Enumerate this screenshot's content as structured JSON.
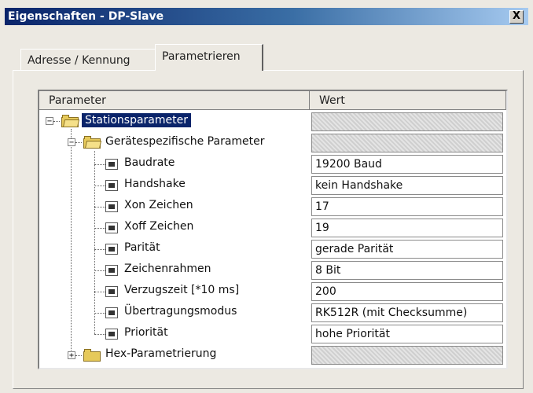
{
  "window": {
    "title": "Eigenschaften - DP-Slave",
    "close_label": "X"
  },
  "tabs": [
    {
      "label": "Adresse / Kennung",
      "active": false
    },
    {
      "label": "Parametrieren",
      "active": true
    }
  ],
  "grid": {
    "columns": [
      "Parameter",
      "Wert"
    ],
    "root": {
      "label": "Stationsparameter",
      "expanded": true,
      "selected": true,
      "value": ""
    },
    "group": {
      "label": "Gerätespezifische Parameter",
      "expanded": true,
      "value": ""
    },
    "params": [
      {
        "label": "Baudrate",
        "value": "19200 Baud"
      },
      {
        "label": "Handshake",
        "value": "kein Handshake"
      },
      {
        "label": "Xon Zeichen",
        "value": "17"
      },
      {
        "label": "Xoff Zeichen",
        "value": "19"
      },
      {
        "label": "Parität",
        "value": "gerade Parität"
      },
      {
        "label": "Zeichenrahmen",
        "value": "8 Bit"
      },
      {
        "label": "Verzugszeit [*10 ms]",
        "value": "200"
      },
      {
        "label": "Übertragungsmodus",
        "value": "RK512R (mit Checksumme)"
      },
      {
        "label": "Priorität",
        "value": "hohe Priorität"
      }
    ],
    "hex": {
      "label": "Hex-Parametrierung",
      "expanded": false,
      "value": ""
    },
    "expander_minus": "−",
    "expander_plus": "+"
  }
}
